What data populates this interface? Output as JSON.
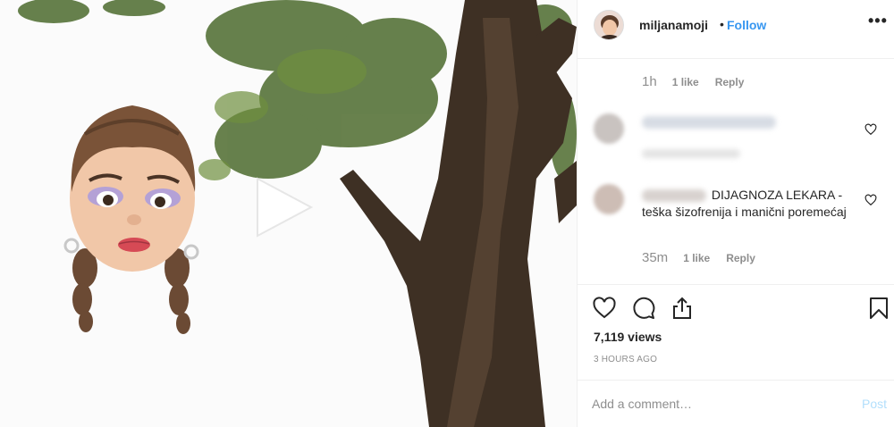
{
  "post": {
    "username": "miljanamoji",
    "separator": "•",
    "follow_label": "Follow",
    "more_icon": "more-options-icon"
  },
  "comments": [
    {
      "time": "1h",
      "likes": "1 like",
      "reply": "Reply"
    },
    {
      "time": "",
      "likes": "",
      "reply": "",
      "text": ""
    },
    {
      "text": "DIJAGNOZA LEKARA - teška šizofrenija i manični poremećaj",
      "time": "35m",
      "likes": "1 like",
      "reply": "Reply"
    }
  ],
  "stats": {
    "views": "7,119 views",
    "time_ago": "3 HOURS AGO"
  },
  "add_comment": {
    "placeholder": "Add a comment…",
    "post_label": "Post"
  },
  "colors": {
    "accent": "#3897f0",
    "post_disabled": "#b2dffc",
    "muted": "#8e8e8e"
  }
}
